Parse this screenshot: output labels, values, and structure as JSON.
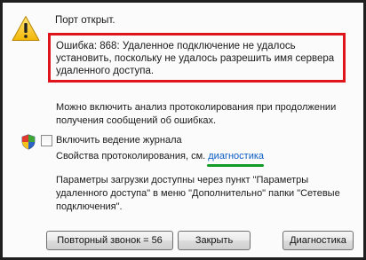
{
  "dialog": {
    "port_status": "Порт открыт.",
    "error_message": "Ошибка: 868: Удаленное подключение не удалось установить, поскольку не удалось разрешить имя сервера удаленного доступа.",
    "analysis_note": "Можно включить анализ протоколирования при продолжении получения сообщений об ошибках.",
    "log_checkbox_label": "Включить ведение журнала",
    "log_checkbox_checked": false,
    "properties_prefix": "Свойства протоколирования, см.",
    "properties_link": "диагностика",
    "params_note": "Параметры загрузки доступны через пункт \"Параметры удаленного доступа\" в меню \"Дополнительно\" папки \"Сетевые подключения\".",
    "icons": {
      "warning": "warning-icon",
      "shield": "shield-icon"
    },
    "colors": {
      "highlight_box": "#e0141b",
      "link": "#0a5cc4",
      "link_underline": "#129a27"
    }
  },
  "buttons": {
    "redial": "Повторный звонок = 56",
    "close": "Закрыть",
    "diagnostics": "Диагностика"
  }
}
